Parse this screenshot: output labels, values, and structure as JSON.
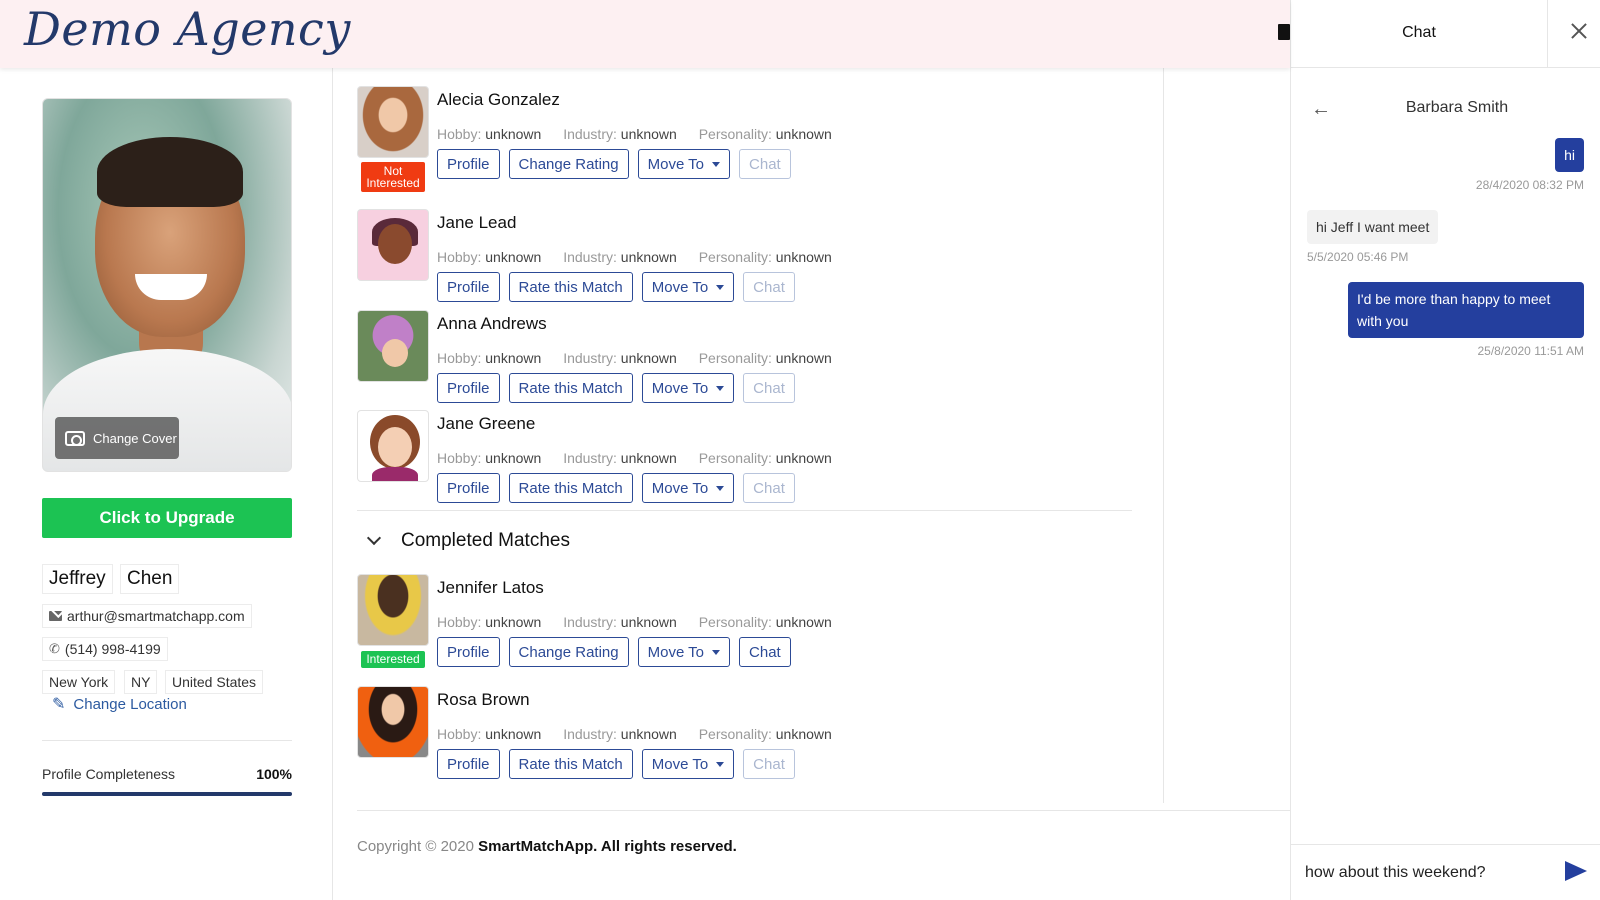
{
  "header": {
    "logo": "Demo Agency"
  },
  "profile": {
    "change_cover": "Change Cover",
    "upgrade": "Click to Upgrade",
    "first_name": "Jeffrey",
    "last_name": "Chen",
    "email": "arthur@smartmatchapp.com",
    "phone": "(514) 998-4199",
    "city": "New York",
    "state": "NY",
    "country": "United States",
    "change_location": "Change Location",
    "completeness_label": "Profile Completeness",
    "completeness_value": "100%",
    "completeness_fraction": 1.0
  },
  "labels": {
    "hobby": "Hobby:",
    "industry": "Industry:",
    "personality": "Personality:",
    "unknown": "unknown",
    "profile": "Profile",
    "change_rating": "Change Rating",
    "rate_match": "Rate this Match",
    "move_to": "Move To",
    "chat": "Chat"
  },
  "matches": [
    {
      "name": "Alecia Gonzalez",
      "hobby": "unknown",
      "industry": "unknown",
      "personality": "unknown",
      "rating_label": "Change Rating",
      "chat_enabled": false,
      "status": "Not Interested"
    },
    {
      "name": "Jane Lead",
      "hobby": "unknown",
      "industry": "unknown",
      "personality": "unknown",
      "rating_label": "Rate this Match",
      "chat_enabled": false,
      "status": ""
    },
    {
      "name": "Anna Andrews",
      "hobby": "unknown",
      "industry": "unknown",
      "personality": "unknown",
      "rating_label": "Rate this Match",
      "chat_enabled": false,
      "status": ""
    },
    {
      "name": "Jane Greene",
      "hobby": "unknown",
      "industry": "unknown",
      "personality": "unknown",
      "rating_label": "Rate this Match",
      "chat_enabled": false,
      "status": ""
    }
  ],
  "completed_section": "Completed Matches",
  "completed": [
    {
      "name": "Jennifer Latos",
      "hobby": "unknown",
      "industry": "unknown",
      "personality": "unknown",
      "rating_label": "Change Rating",
      "chat_enabled": true,
      "status": "Interested"
    },
    {
      "name": "Rosa Brown",
      "hobby": "unknown",
      "industry": "unknown",
      "personality": "unknown",
      "rating_label": "Rate this Match",
      "chat_enabled": false,
      "status": ""
    }
  ],
  "footer": {
    "prefix": "Copyright © 2020",
    "brand": "SmartMatchApp. All rights reserved."
  },
  "chat": {
    "title": "Chat",
    "contact": "Barbara Smith",
    "messages": [
      {
        "direction": "out",
        "text": "hi",
        "time": "28/4/2020 08:32 PM"
      },
      {
        "direction": "in",
        "text": "hi Jeff I want meet",
        "time": "5/5/2020 05:46 PM"
      },
      {
        "direction": "out",
        "text": "I'd be more than happy to meet with you",
        "time": "25/8/2020 11:51 AM"
      }
    ],
    "input_value": "how about this weekend?"
  },
  "colors": {
    "primary": "#243f9e",
    "upgrade": "#1cc353",
    "not_interested": "#f03b12",
    "interested": "#1cc353",
    "header_bg": "#fdf0f2"
  }
}
